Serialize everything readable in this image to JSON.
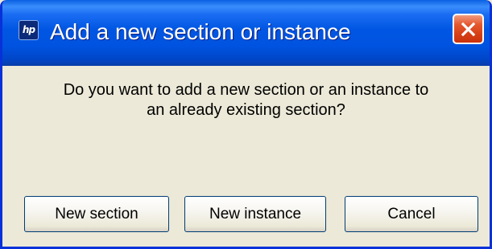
{
  "dialog": {
    "title": "Add a new section or instance",
    "app_icon": {
      "name": "hp-icon",
      "glyph": "hp"
    },
    "close_icon": "close-icon",
    "message_lines": [
      "Do you want to add a new section or an instance to",
      "an already existing section?"
    ],
    "buttons": {
      "new_section": "New section",
      "new_instance": "New instance",
      "cancel": "Cancel"
    },
    "colors": {
      "titlebar": "#0054e3",
      "window_border": "#0831d9",
      "client_background": "#ece9d8",
      "close_button": "#e04e24",
      "button_border": "#003c74"
    }
  }
}
